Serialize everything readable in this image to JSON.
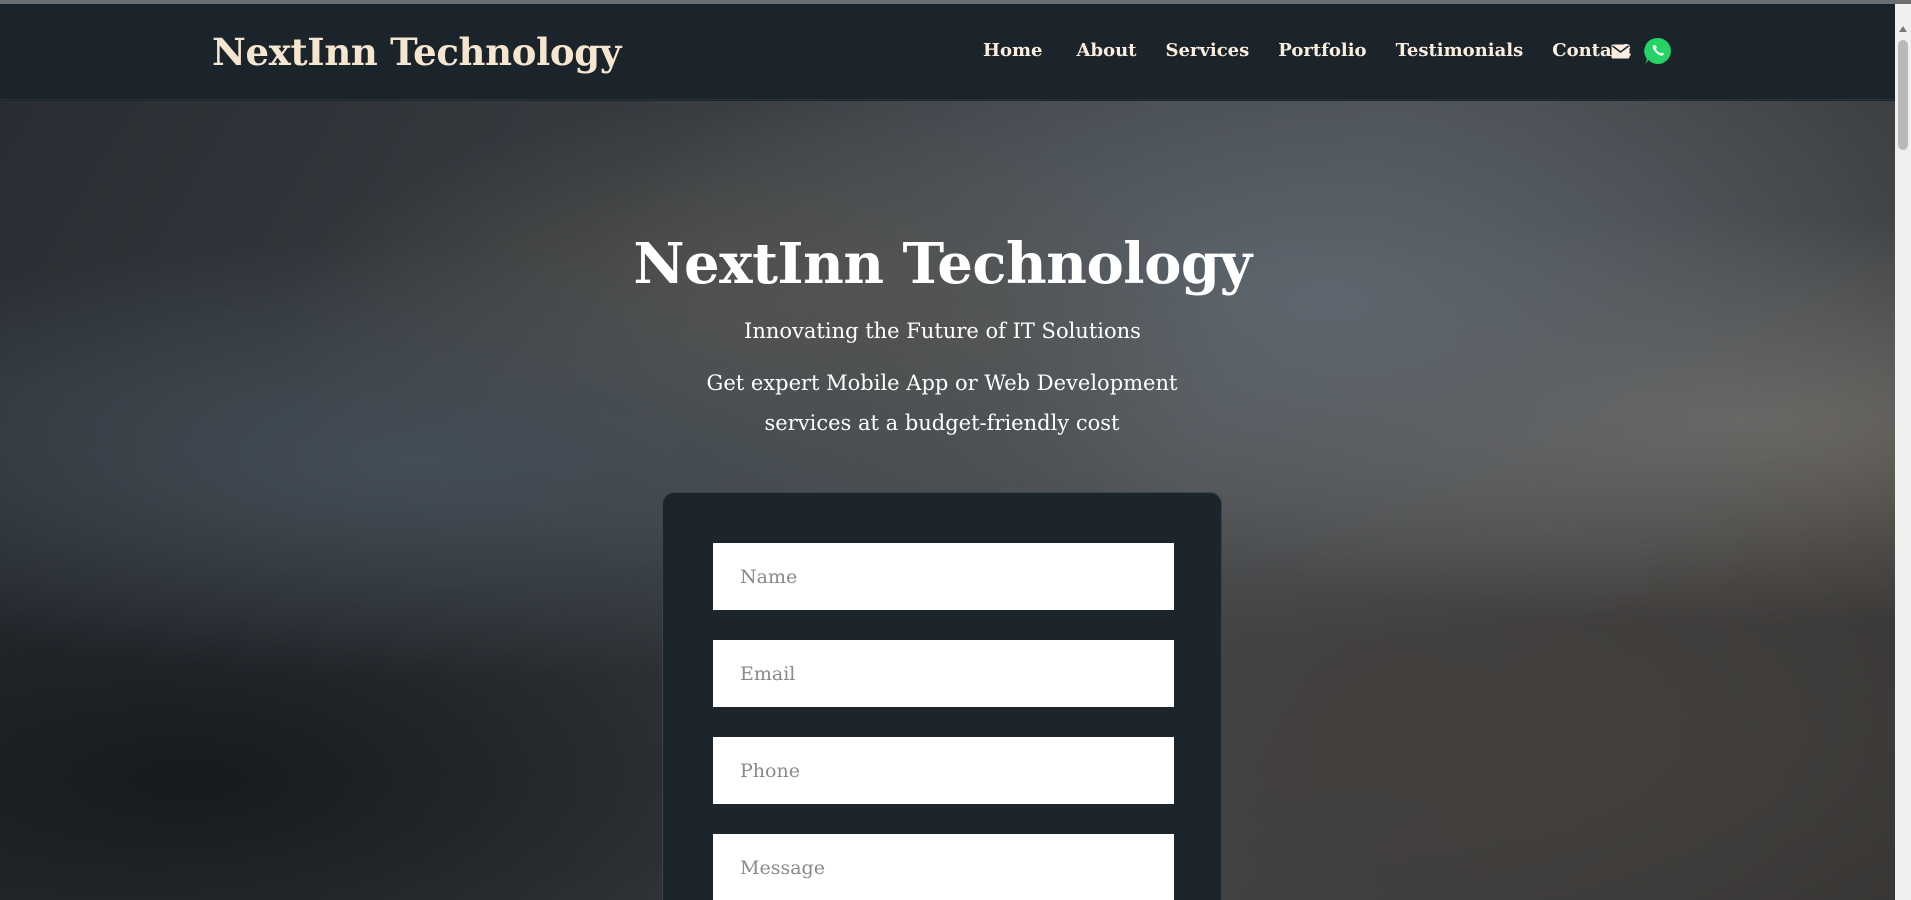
{
  "header": {
    "brand": "NextInn Technology",
    "nav": [
      {
        "label": "Home"
      },
      {
        "label": "About"
      },
      {
        "label": "Services"
      },
      {
        "label": "Portfolio"
      },
      {
        "label": "Testimonials"
      },
      {
        "label": "Contact"
      }
    ],
    "icons": [
      "mail-icon",
      "whatsapp-icon"
    ]
  },
  "hero": {
    "title": "NextInn Technology",
    "tagline": "Innovating the Future of IT Solutions",
    "description": "Get expert Mobile App or Web Development services at a budget-friendly cost"
  },
  "form": {
    "name_placeholder": "Name",
    "email_placeholder": "Email",
    "phone_placeholder": "Phone",
    "message_placeholder": "Message"
  },
  "colors": {
    "nav_bg": "#1b242a",
    "brand_text": "#f6e6cf",
    "whatsapp": "#25d366"
  }
}
